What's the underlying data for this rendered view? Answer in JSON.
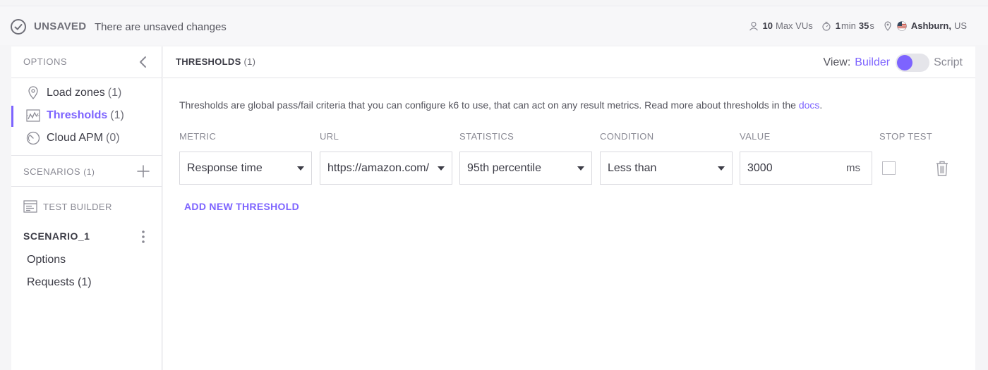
{
  "topbar": {
    "status": "UNSAVED",
    "message": "There are unsaved changes",
    "vus_value": "10",
    "vus_label": "Max VUs",
    "duration_min": "1",
    "duration_min_unit": "min",
    "duration_sec": "35",
    "duration_sec_unit": "s",
    "location_city": "Ashburn,",
    "location_country": "US"
  },
  "sidebar": {
    "options_label": "OPTIONS",
    "items": [
      {
        "label": "Load zones",
        "count": "(1)",
        "icon": "location-pin-icon"
      },
      {
        "label": "Thresholds",
        "count": "(1)",
        "icon": "threshold-chart-icon",
        "active": true
      },
      {
        "label": "Cloud APM",
        "count": "(0)",
        "icon": "gauge-icon"
      }
    ],
    "scenarios_label": "SCENARIOS",
    "scenarios_count": "(1)",
    "test_builder_label": "TEST BUILDER",
    "scenario_name": "SCENARIO_1",
    "scenario_items": [
      "Options",
      "Requests (1)"
    ]
  },
  "main": {
    "title": "THRESHOLDS",
    "title_count": "(1)",
    "view_label": "View:",
    "view_builder": "Builder",
    "view_script": "Script",
    "description": "Thresholds are global pass/fail criteria that you can configure k6 to use, that can act on any result metrics. Read more about thresholds in the",
    "docs_link": "docs",
    "description_end": ".",
    "columns": [
      "METRIC",
      "URL",
      "STATISTICS",
      "CONDITION",
      "VALUE",
      "STOP TEST"
    ],
    "row": {
      "metric": "Response time",
      "url": "https://amazon.com/",
      "statistic": "95th percentile",
      "condition": "Less than",
      "value": "3000",
      "unit": "ms",
      "stop_test": false
    },
    "add_button": "ADD NEW THRESHOLD"
  },
  "colors": {
    "accent": "#7d64ff",
    "text": "#3c3c46",
    "muted": "#8a8a94",
    "border": "#e3e3e8"
  }
}
